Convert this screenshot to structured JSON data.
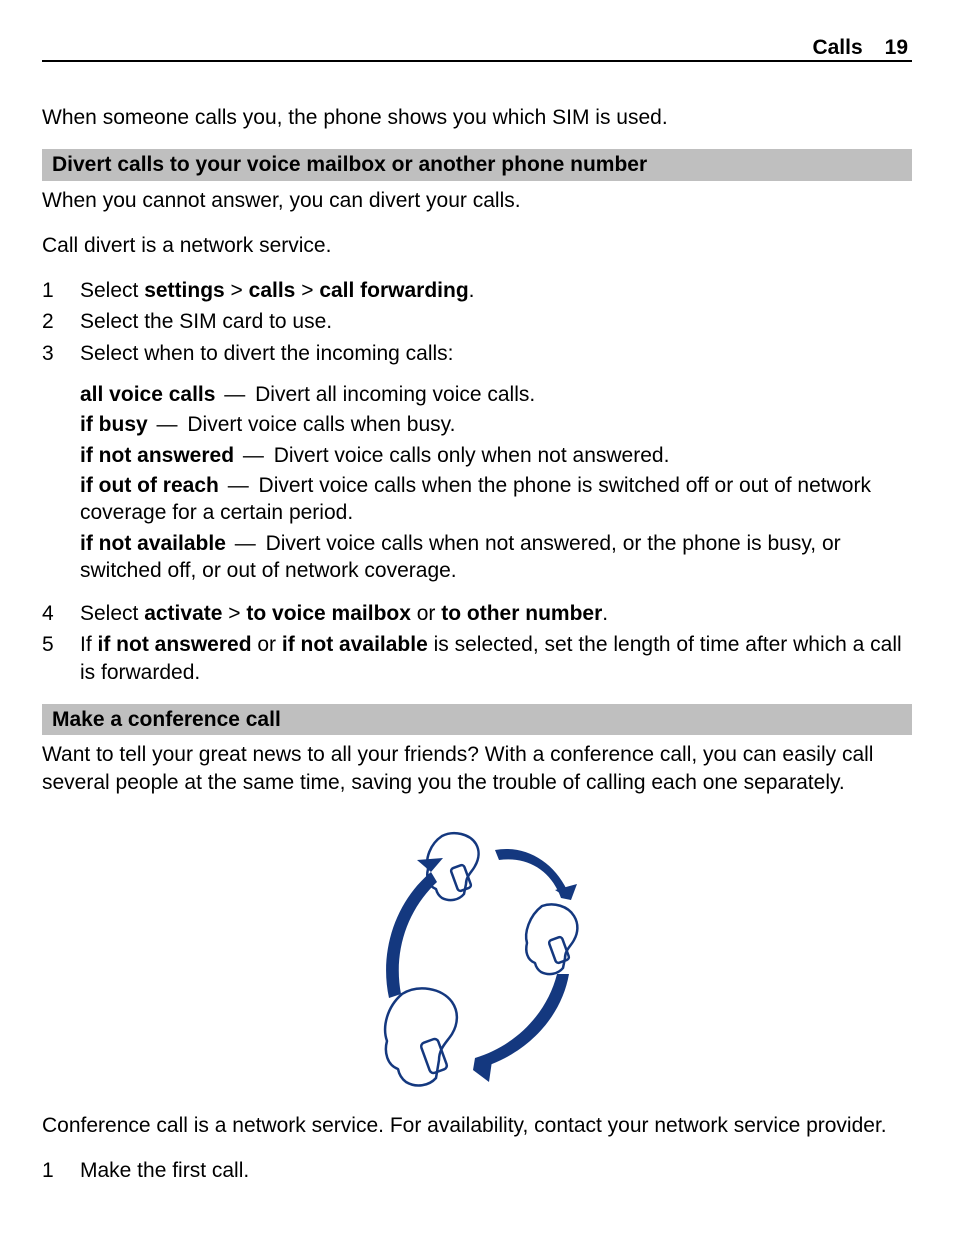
{
  "header": {
    "section": "Calls",
    "page_number": "19"
  },
  "intro_para": "When someone calls you, the phone shows you which SIM is used.",
  "section1": {
    "heading": "Divert calls to your voice mailbox or another phone number",
    "para1": "When you cannot answer, you can divert your calls.",
    "para2": "Call divert is a network service.",
    "step1_prefix": "Select ",
    "step1_b1": "settings",
    "step1_gt1": " > ",
    "step1_b2": "calls",
    "step1_gt2": " > ",
    "step1_b3": "call forwarding",
    "step1_suffix": ".",
    "step2": "Select the SIM card to use.",
    "step3": "Select when to divert the incoming calls:",
    "defs": [
      {
        "term": "all voice calls",
        "desc": "Divert all incoming voice calls."
      },
      {
        "term": "if busy",
        "desc": "Divert voice calls when busy."
      },
      {
        "term": "if not answered",
        "desc": "Divert voice calls only when not answered."
      },
      {
        "term": "if out of reach",
        "desc": "Divert voice calls when the phone is switched off or out of network coverage for a certain period."
      },
      {
        "term": "if not available",
        "desc": "Divert voice calls when not answered, or the phone is busy, or switched off, or out of network coverage."
      }
    ],
    "step4_prefix": "Select ",
    "step4_b1": "activate",
    "step4_gt1": " > ",
    "step4_b2": "to voice mailbox",
    "step4_or": " or ",
    "step4_b3": "to other number",
    "step4_suffix": ".",
    "step5_prefix": "If ",
    "step5_b1": "if not answered",
    "step5_or": " or ",
    "step5_b2": "if not available",
    "step5_suffix": " is selected, set the length of time after which a call is forwarded.",
    "nums": {
      "n1": "1",
      "n2": "2",
      "n3": "3",
      "n4": "4",
      "n5": "5"
    }
  },
  "section2": {
    "heading": "Make a conference call",
    "para1": "Want to tell your great news to all your friends? With a conference call, you can easily call several people at the same time, saving you the trouble of calling each one separately.",
    "para2": "Conference call is a network service. For availability, contact your network service provider.",
    "step1_num": "1",
    "step1": "Make the first call."
  },
  "dash": "—"
}
